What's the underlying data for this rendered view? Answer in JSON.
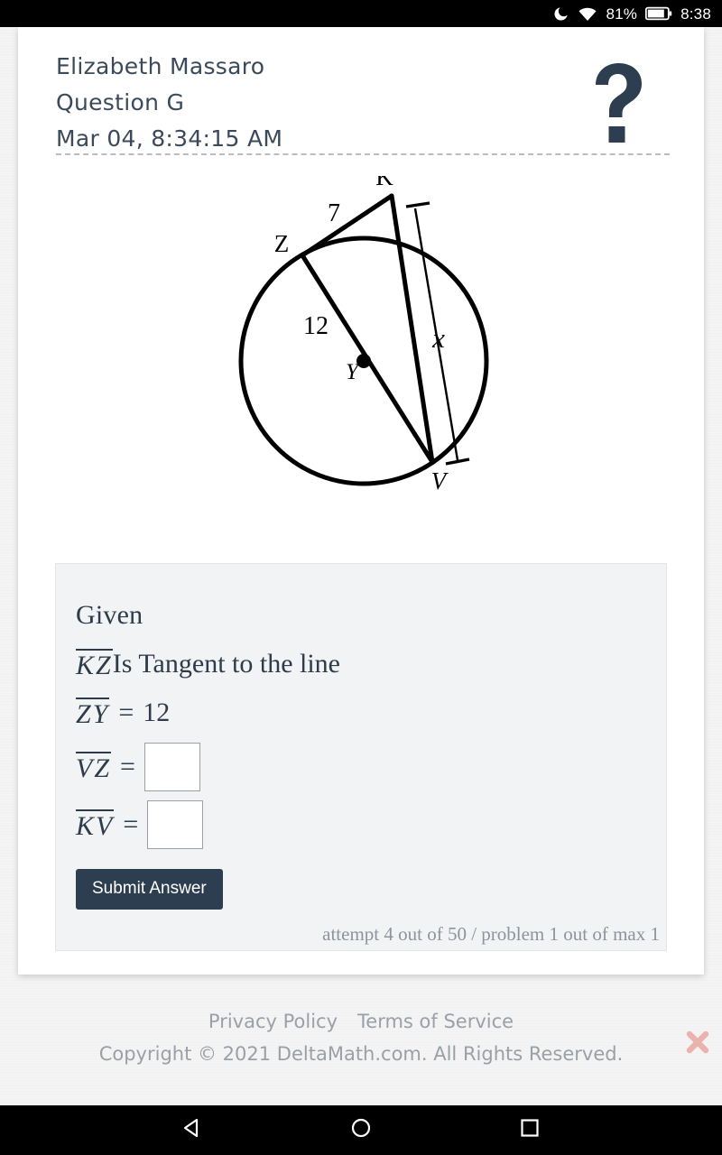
{
  "status_bar": {
    "dnd_icon": "moon-icon",
    "wifi_icon": "wifi-icon",
    "battery_percent": "81%",
    "battery_icon": "battery-icon",
    "clock": "8:38"
  },
  "header": {
    "student_name": "Elizabeth Massaro",
    "question_label": "Question G",
    "timestamp": "Mar 04, 8:34:15 AM",
    "help_icon": "question-mark-icon"
  },
  "figure": {
    "type": "circle-geometry-diagram",
    "labels": {
      "point_k": "K",
      "point_z": "Z",
      "point_y": "Y",
      "point_v": "V",
      "tangent_length": "7",
      "radius_length": "12",
      "unknown": "x"
    }
  },
  "given": {
    "title": "Given",
    "rows": [
      {
        "segment": "KZ",
        "text": "Is Tangent to the line"
      },
      {
        "segment": "ZY",
        "equals": "=",
        "value": "12"
      },
      {
        "segment": "VZ",
        "equals": "=",
        "input_value": "",
        "input_placeholder": ""
      },
      {
        "segment": "KV",
        "equals": "=",
        "input_value": "",
        "input_placeholder": ""
      }
    ]
  },
  "actions": {
    "submit_label": "Submit Answer",
    "attempt_status": "attempt 4 out of 50 / problem 1 out of max 1"
  },
  "footer": {
    "privacy_policy": "Privacy Policy",
    "terms_of_service": "Terms of Service",
    "copyright": "Copyright © 2021 DeltaMath.com. All Rights Reserved.",
    "close_icon": "close-x-icon"
  },
  "nav_bar": {
    "back": "back-triangle-icon",
    "home": "home-circle-icon",
    "recents": "recents-square-icon"
  },
  "colors": {
    "accent_dark": "#2c3e50",
    "panel_bg": "#f1f3f5",
    "muted_text": "#9aa0a6",
    "close_red": "#e05c4f"
  }
}
